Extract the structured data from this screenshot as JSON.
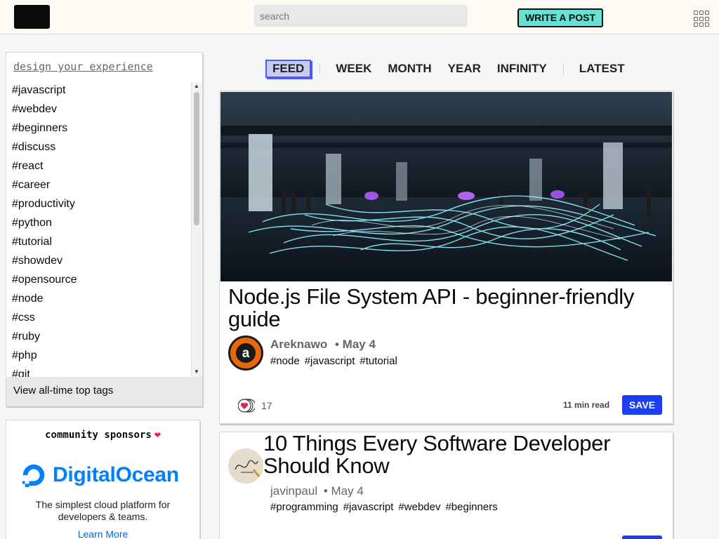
{
  "header": {
    "search_placeholder": "search",
    "write_button": "WRITE A POST",
    "menu_icon": "grid-icon"
  },
  "sidebar": {
    "tags_title": "design your experience",
    "tags": [
      "#javascript",
      "#webdev",
      "#beginners",
      "#discuss",
      "#react",
      "#career",
      "#productivity",
      "#python",
      "#tutorial",
      "#showdev",
      "#opensource",
      "#node",
      "#css",
      "#ruby",
      "#php",
      "#git"
    ],
    "view_all": "View all-time top tags",
    "sponsors_title": "community sponsors",
    "sponsor": {
      "name": "DigitalOcean",
      "tagline_1": "The simplest cloud platform for",
      "tagline_2": "developers & teams.",
      "link": "Learn More",
      "brand_color": "#0080ff"
    }
  },
  "tabs": [
    "FEED",
    "WEEK",
    "MONTH",
    "YEAR",
    "INFINITY",
    "LATEST"
  ],
  "active_tab": "FEED",
  "articles": [
    {
      "title": "Node.js File System API - beginner-friendly guide",
      "author": "Areknawo",
      "date": "• May 4",
      "tags": [
        "#node",
        "#javascript",
        "#tutorial"
      ],
      "reactions": "17",
      "read_time": "11 min read",
      "save": "SAVE"
    },
    {
      "title": "10 Things Every Software Developer Should Know",
      "author": "javinpaul",
      "date": "• May 4",
      "tags": [
        "#programming",
        "#javascript",
        "#webdev",
        "#beginners"
      ]
    }
  ],
  "colors": {
    "accent": "#4e57ef",
    "write_button": "#66e2d5",
    "save_button": "#1c3df0",
    "heart": "#e0254b"
  }
}
